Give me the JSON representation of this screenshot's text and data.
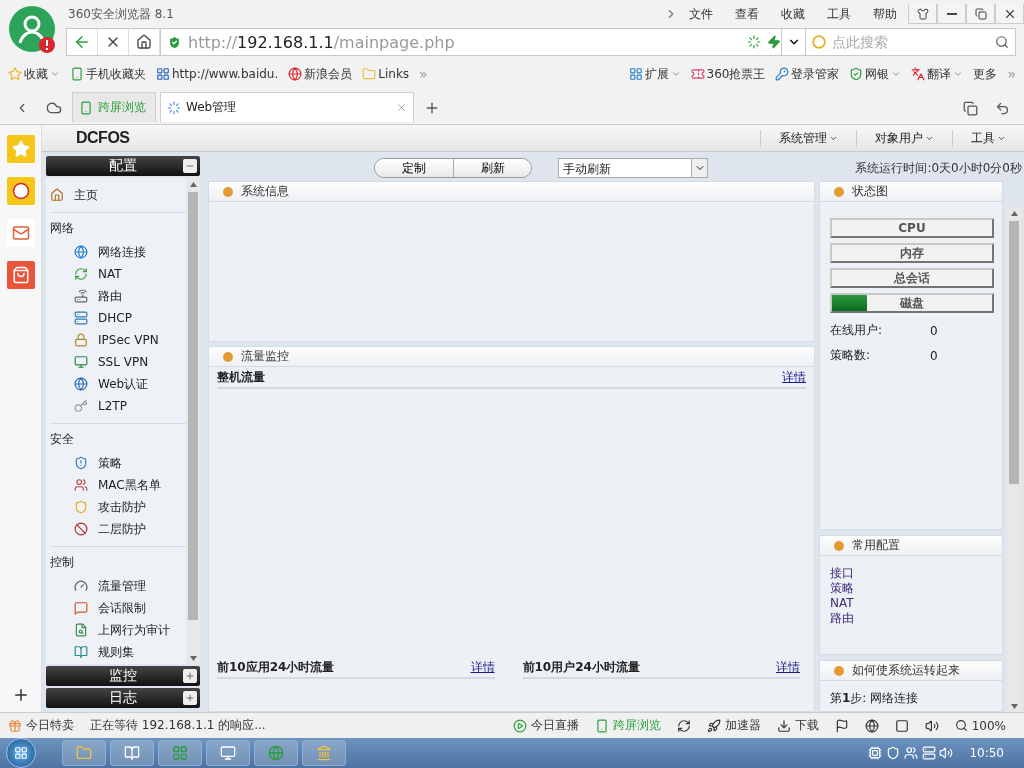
{
  "browser": {
    "title": "360安全浏览器 8.1",
    "menu": [
      "文件",
      "查看",
      "收藏",
      "工具",
      "帮助"
    ],
    "address": {
      "scheme": "http://",
      "host": "192.168.1.1",
      "path": "/mainpage.php"
    },
    "search": {
      "placeholder": "点此搜索"
    },
    "bookmarks": [
      {
        "label": "收藏",
        "menu": true
      },
      {
        "label": "手机收藏夹",
        "menu": false
      },
      {
        "label": "http://www.baidu.",
        "menu": false
      },
      {
        "label": "新浪会员",
        "menu": false
      },
      {
        "label": "Links",
        "menu": false
      }
    ],
    "more_bookmarks": "»",
    "tools": [
      {
        "label": "扩展",
        "menu": true
      },
      {
        "label": "360抢票王",
        "menu": false
      },
      {
        "label": "登录管家",
        "menu": false
      },
      {
        "label": "网银",
        "menu": true
      },
      {
        "label": "翻译",
        "menu": true
      },
      {
        "label": "更多",
        "menu": false
      }
    ],
    "more_tools": "»",
    "tabs": [
      {
        "label": "跨屏浏览",
        "selected": false
      },
      {
        "label": "Web管理",
        "selected": true
      }
    ]
  },
  "page": {
    "logo": "DCFOS",
    "menus": [
      "系统管理",
      "对象用户",
      "工具"
    ],
    "nav": [
      {
        "title": "配置",
        "expanded": true,
        "groups": [
          {
            "items": [
              "主页"
            ]
          },
          {
            "title": "网络",
            "items": [
              "网络连接",
              "NAT",
              "路由",
              "DHCP",
              "IPSec VPN",
              "SSL VPN",
              "Web认证",
              "L2TP"
            ]
          },
          {
            "title": "安全",
            "items": [
              "策略",
              "MAC黑名单",
              "攻击防护",
              "二层防护"
            ]
          },
          {
            "title": "控制",
            "items": [
              "流量管理",
              "会话限制",
              "上网行为审计",
              "规则集"
            ]
          }
        ]
      },
      {
        "title": "监控",
        "expanded": false
      },
      {
        "title": "日志",
        "expanded": false
      }
    ],
    "toolbar": {
      "buttons": [
        "定制",
        "刷新"
      ],
      "refresh_mode": "手动刷新",
      "uptime": "系统运行时间:0天0小时0分0秒"
    },
    "system_info": {
      "title": "系统信息"
    },
    "traffic": {
      "title": "流量监控",
      "main": {
        "title": "整机流量",
        "link": "详情"
      },
      "bottom": [
        {
          "title": "前10应用24小时流量",
          "link": "详情"
        },
        {
          "title": "前10用户24小时流量",
          "link": "详情"
        }
      ]
    },
    "status": {
      "title": "状态图",
      "meters": [
        {
          "label": "CPU"
        },
        {
          "label": "内存"
        },
        {
          "label": "总会话"
        },
        {
          "label": "磁盘",
          "level": 0.22
        }
      ],
      "stats": [
        {
          "label": "在线用户:",
          "value": "0"
        },
        {
          "label": "策略数:",
          "value": "0"
        }
      ]
    },
    "common": {
      "title": "常用配置",
      "links": [
        "接口",
        "策略",
        "NAT",
        "路由"
      ]
    },
    "howto": {
      "title": "如何使系统运转起来",
      "steps": [
        "第**1**步: 网络连接"
      ]
    }
  },
  "status_bar": {
    "promo": "今日特卖",
    "message": "正在等待 192.168.1.1 的响应...",
    "live": "今日直播",
    "cross": "跨屏浏览",
    "accelerator": "加速器",
    "download": "下载",
    "zoom": "100%"
  },
  "taskbar": {
    "clock": "10:50"
  }
}
